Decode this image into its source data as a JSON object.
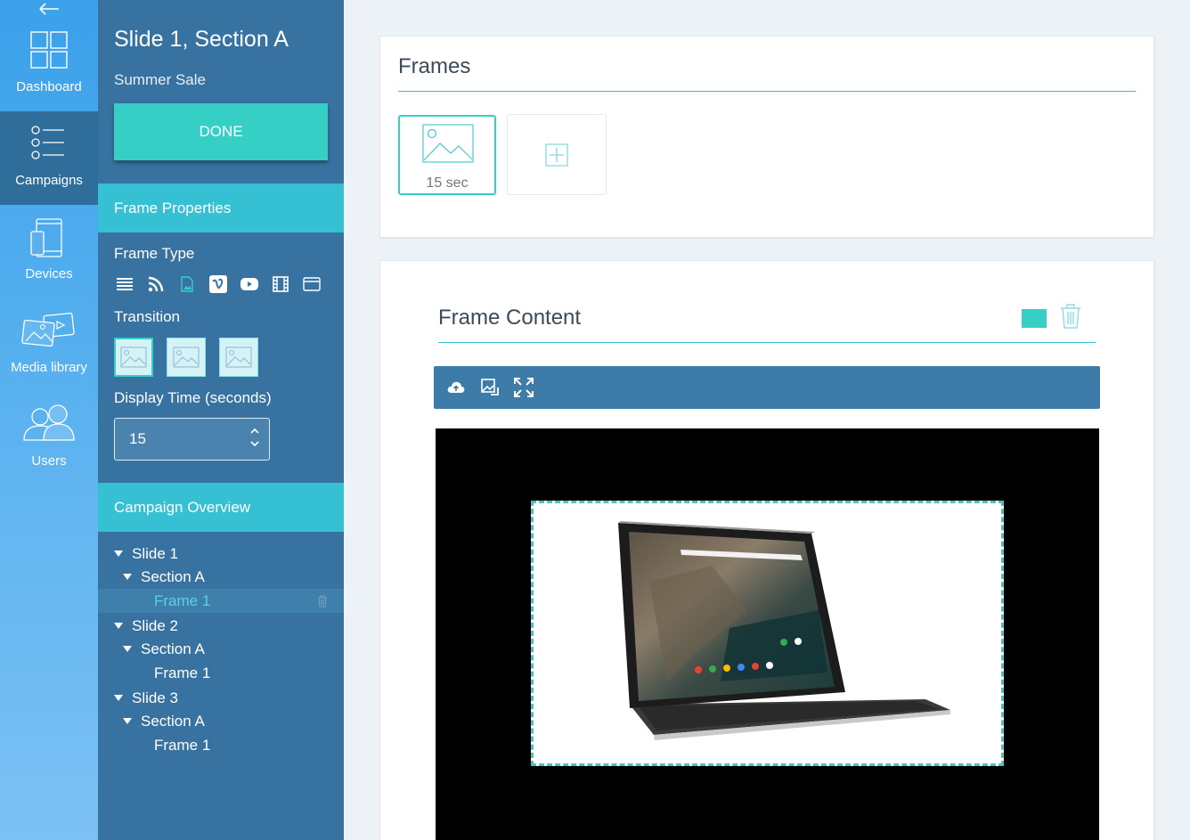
{
  "nav": {
    "items": [
      {
        "label": "Dashboard",
        "icon": "dashboard-grid-icon"
      },
      {
        "label": "Campaigns",
        "icon": "list-icon"
      },
      {
        "label": "Devices",
        "icon": "devices-icon"
      },
      {
        "label": "Media library",
        "icon": "media-library-icon"
      },
      {
        "label": "Users",
        "icon": "users-icon"
      }
    ],
    "active": "Campaigns"
  },
  "panel": {
    "title": "Slide 1, Section A",
    "subtitle": "Summer Sale",
    "done_label": "DONE",
    "frame_properties_label": "Frame Properties",
    "frame_type_label": "Frame Type",
    "frame_type_icons": [
      "list-icon",
      "rss-icon",
      "image-icon",
      "vimeo-icon",
      "youtube-icon",
      "film-icon",
      "browser-icon"
    ],
    "frame_type_selected": "image-icon",
    "transition_label": "Transition",
    "display_time_label": "Display Time (seconds)",
    "display_time_value": "15",
    "campaign_overview_label": "Campaign Overview"
  },
  "tree": [
    {
      "label": "Slide 1",
      "level": 0
    },
    {
      "label": "Section A",
      "level": 1
    },
    {
      "label": "Frame 1",
      "level": 2,
      "selected": true
    },
    {
      "label": "Slide 2",
      "level": 0
    },
    {
      "label": "Section A",
      "level": 1
    },
    {
      "label": "Frame 1",
      "level": 2
    },
    {
      "label": "Slide 3",
      "level": 0
    },
    {
      "label": "Section A",
      "level": 1
    },
    {
      "label": "Frame 1",
      "level": 2
    }
  ],
  "frames": {
    "title": "Frames",
    "items": [
      {
        "duration": "15 sec"
      }
    ]
  },
  "frame_content": {
    "title": "Frame Content",
    "color_swatch": "#36cfc5",
    "toolbar_icons": [
      "upload-icon",
      "replace-image-icon",
      "fullscreen-icon"
    ]
  },
  "colors": {
    "accent": "#36cfc5",
    "panel": "#3872a0",
    "section_bar": "#36c0d3"
  }
}
